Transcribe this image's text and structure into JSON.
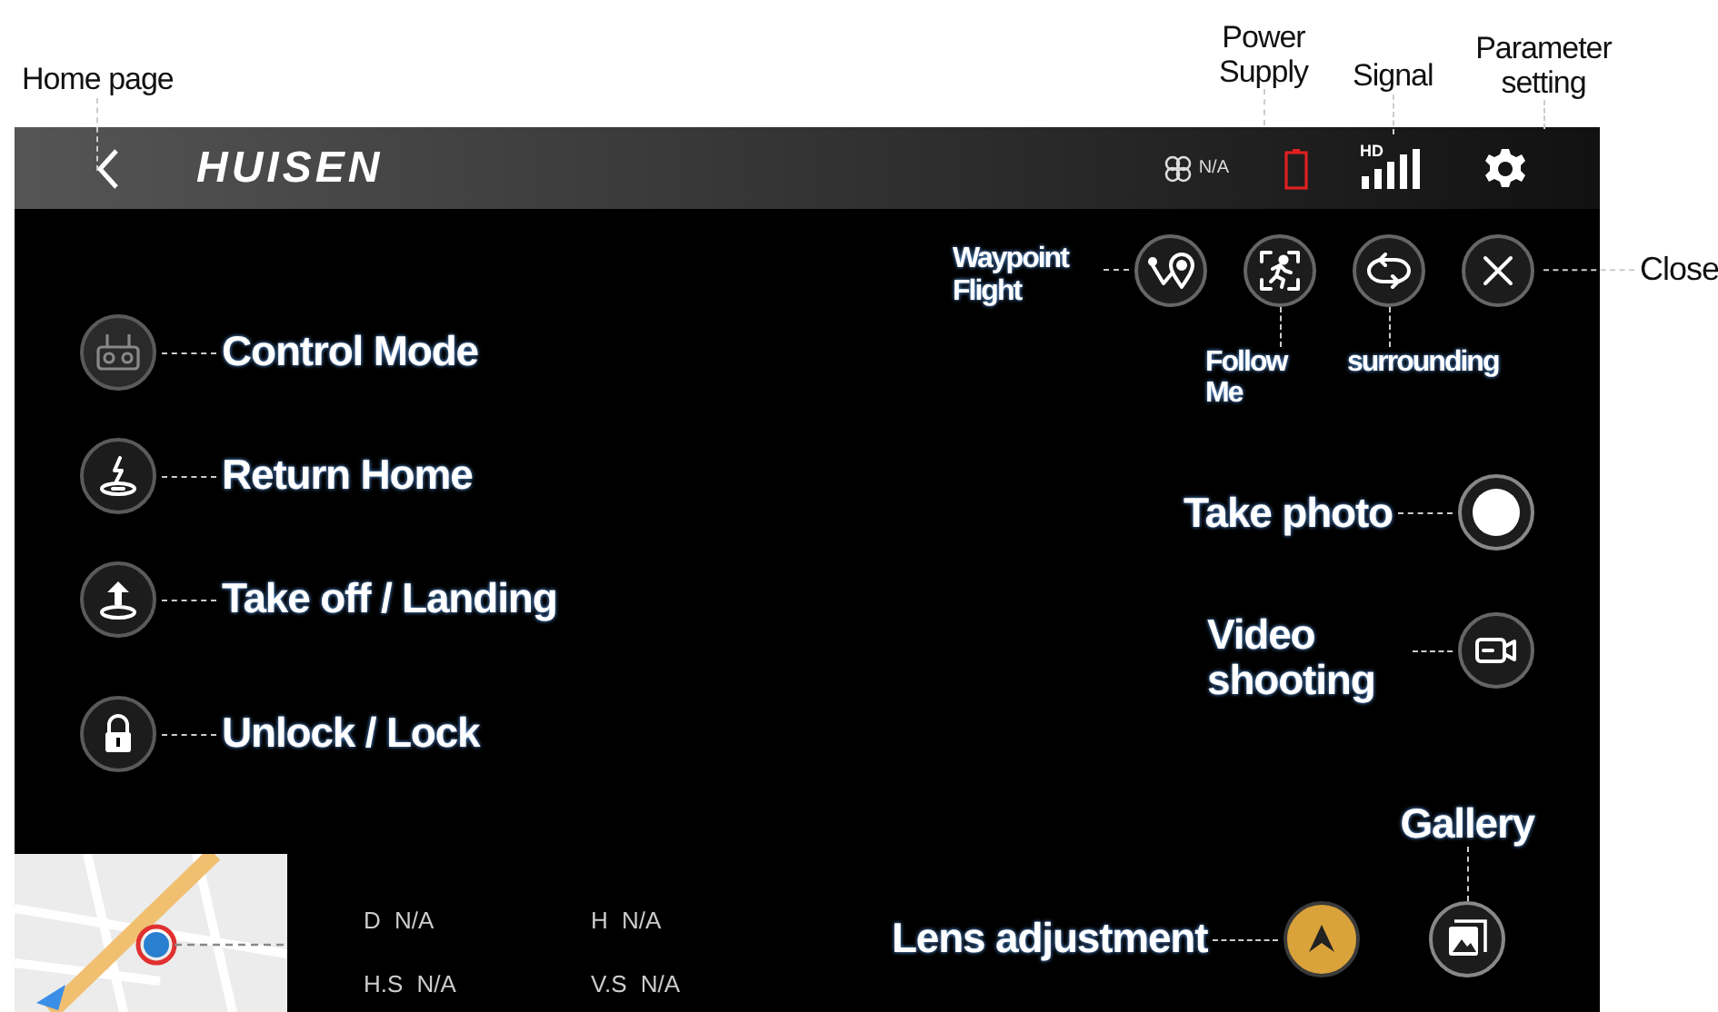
{
  "annotations": {
    "home_page": "Home page",
    "power_supply": "Power Supply",
    "signal": "Signal",
    "parameter_setting": "Parameter setting"
  },
  "top_bar": {
    "brand": "HUISEN",
    "drone_status": "N/A",
    "signal_badge": "HD"
  },
  "mode_buttons": [
    {
      "kind": "waypoint",
      "label": "Waypoint Flight"
    },
    {
      "kind": "follow",
      "label": "Follow Me"
    },
    {
      "kind": "surround",
      "label": "surrounding"
    },
    {
      "kind": "close",
      "label": "Close"
    }
  ],
  "left_controls": [
    {
      "kind": "control_mode",
      "label": "Control Mode"
    },
    {
      "kind": "return_home",
      "label": "Return Home"
    },
    {
      "kind": "takeoff",
      "label": "Take off / Landing"
    },
    {
      "kind": "lock",
      "label": "Unlock / Lock"
    }
  ],
  "camera": {
    "take_photo": "Take photo",
    "video": "Video shooting",
    "gallery": "Gallery",
    "lens": "Lens adjustment"
  },
  "telemetry": [
    {
      "label": "D",
      "value": "N/A"
    },
    {
      "label": "H",
      "value": "N/A"
    },
    {
      "label": "H.S",
      "value": "N/A"
    },
    {
      "label": "V.S",
      "value": "N/A"
    }
  ]
}
